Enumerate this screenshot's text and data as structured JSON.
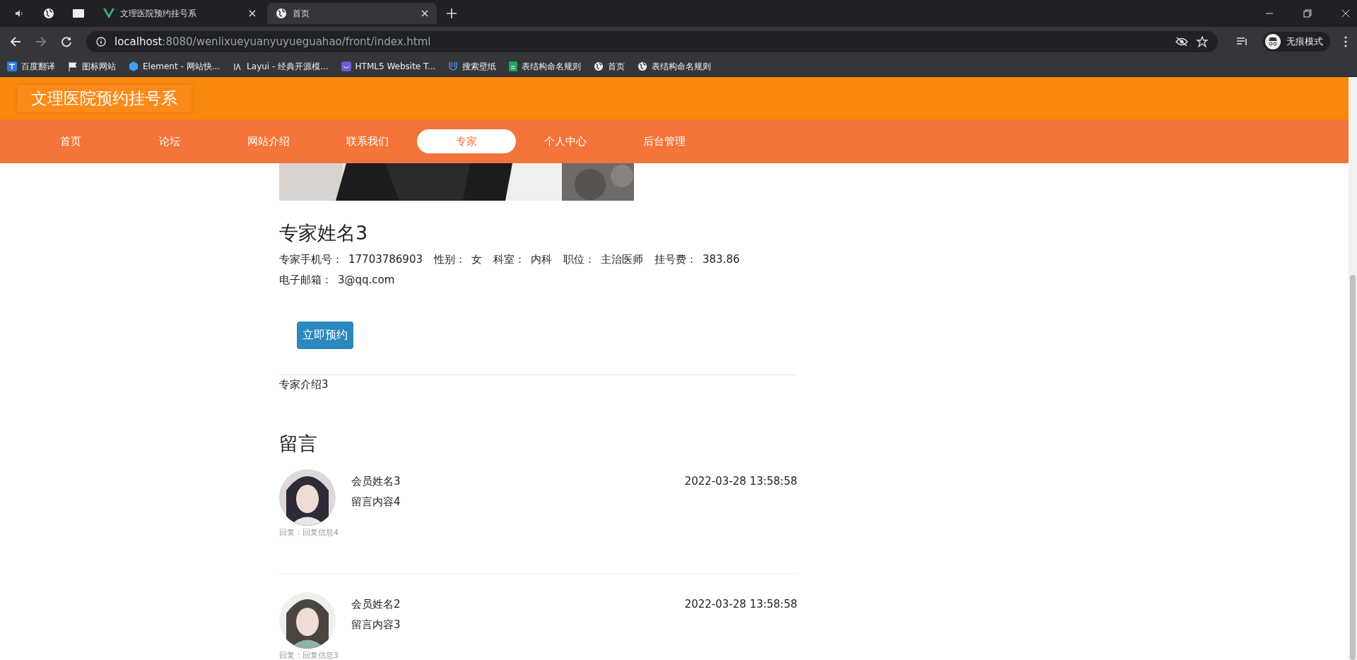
{
  "browser": {
    "tabs": [
      {
        "kind": "audio",
        "selected": false
      },
      {
        "kind": "globe",
        "selected": false
      },
      {
        "kind": "blank",
        "selected": false
      },
      {
        "kind": "vue",
        "title": "文理医院预约挂号系",
        "selected": false
      },
      {
        "kind": "globe",
        "title": "首页",
        "selected": true
      }
    ],
    "url_host": "localhost",
    "url_rest": ":8080/wenlixueyuanyuyueguahao/front/index.html",
    "profile": "无痕模式",
    "bookmarks": [
      {
        "kind": "translate",
        "label": "百度翻译"
      },
      {
        "kind": "flag",
        "label": "图标网站"
      },
      {
        "kind": "element",
        "label": "Element - 网站快..."
      },
      {
        "kind": "layui",
        "label": "Layui - 经典开源模..."
      },
      {
        "kind": "html5",
        "label": "HTML5 Website T..."
      },
      {
        "kind": "wallpaper",
        "label": "搜索壁纸"
      },
      {
        "kind": "sheet",
        "label": "表结构命名规则"
      },
      {
        "kind": "globe",
        "label": "首页"
      },
      {
        "kind": "globe",
        "label": "表结构命名规则"
      }
    ]
  },
  "site_title": "文理医院预约挂号系",
  "nav": [
    {
      "label": "首页",
      "selected": false
    },
    {
      "label": "论坛",
      "selected": false
    },
    {
      "label": "网站介绍",
      "selected": false
    },
    {
      "label": "联系我们",
      "selected": false
    },
    {
      "label": "专家",
      "selected": true
    },
    {
      "label": "个人中心",
      "selected": false
    },
    {
      "label": "后台管理",
      "selected": false
    }
  ],
  "expert": {
    "name": "专家姓名3",
    "fields": [
      {
        "label": "专家手机号：",
        "value": "17703786903"
      },
      {
        "label": "性别：",
        "value": "女"
      },
      {
        "label": "科室：",
        "value": "内科"
      },
      {
        "label": "职位：",
        "value": "主治医师"
      },
      {
        "label": "挂号费：",
        "value": "383.86"
      }
    ],
    "email_label": "电子邮箱：",
    "email": "3@qq.com",
    "book_button": "立即预约",
    "intro": "专家介绍3"
  },
  "comments_heading": "留言",
  "comments": [
    {
      "name": "会员姓名3",
      "content": "留言内容4",
      "time": "2022-03-28 13:58:58",
      "reply": "回复：回复信息4"
    },
    {
      "name": "会员姓名2",
      "content": "留言内容3",
      "time": "2022-03-28 13:58:58",
      "reply": "回复：回复信息3"
    }
  ]
}
